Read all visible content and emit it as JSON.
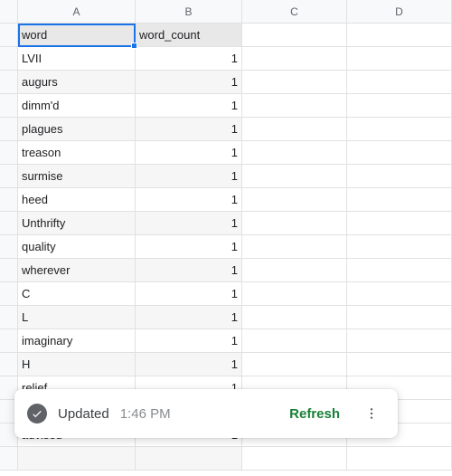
{
  "columns": [
    "A",
    "B",
    "C",
    "D"
  ],
  "header_row": {
    "a": "word",
    "b": "word_count"
  },
  "rows": [
    {
      "a": "LVII",
      "b": "1"
    },
    {
      "a": "augurs",
      "b": "1"
    },
    {
      "a": "dimm'd",
      "b": "1"
    },
    {
      "a": "plagues",
      "b": "1"
    },
    {
      "a": "treason",
      "b": "1"
    },
    {
      "a": "surmise",
      "b": "1"
    },
    {
      "a": "heed",
      "b": "1"
    },
    {
      "a": "Unthrifty",
      "b": "1"
    },
    {
      "a": "quality",
      "b": "1"
    },
    {
      "a": "wherever",
      "b": "1"
    },
    {
      "a": "C",
      "b": "1"
    },
    {
      "a": "L",
      "b": "1"
    },
    {
      "a": "imaginary",
      "b": "1"
    },
    {
      "a": "H",
      "b": "1"
    },
    {
      "a": "relief",
      "b": "1"
    },
    {
      "a": "",
      "b": ""
    },
    {
      "a": "advised",
      "b": "1"
    },
    {
      "a": "",
      "b": ""
    }
  ],
  "toast": {
    "status": "Updated",
    "time": "1:46 PM",
    "refresh": "Refresh"
  },
  "active_cell": "A1"
}
